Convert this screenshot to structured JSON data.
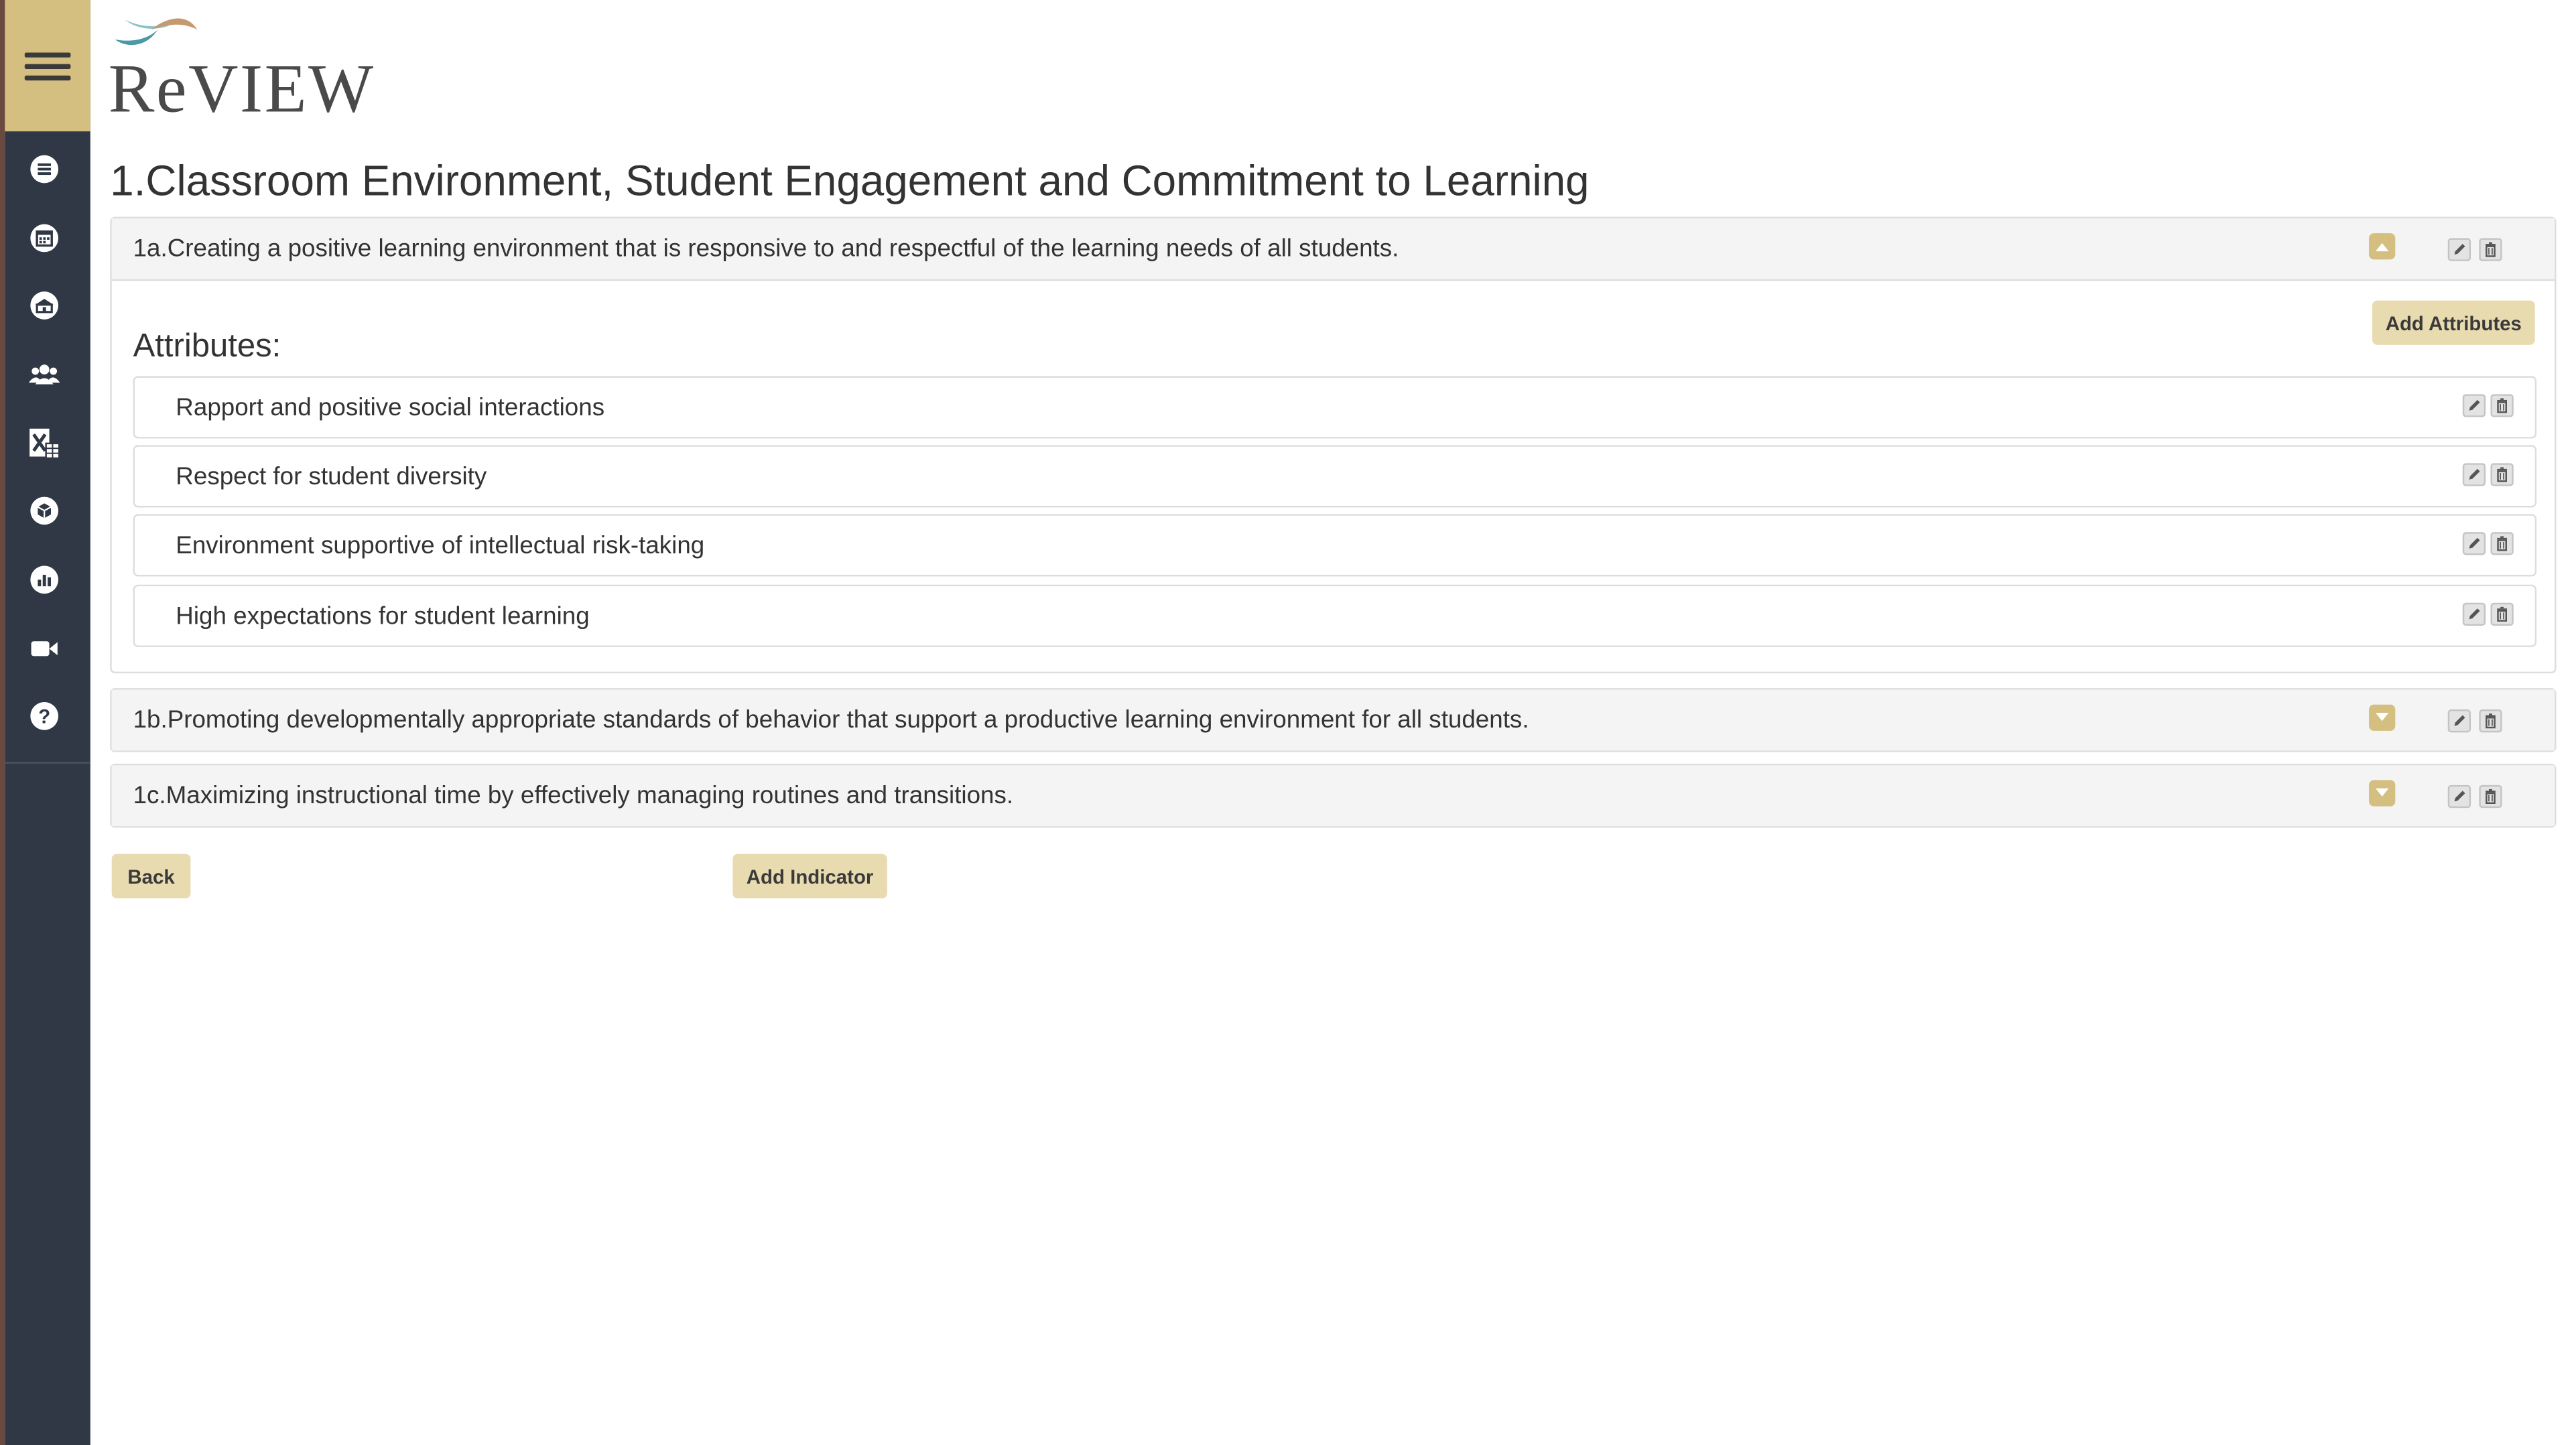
{
  "app": {
    "brand": "ReVIEW",
    "colors": {
      "sidebar": "#303845",
      "accent": "#d4be80",
      "button": "#e9dbb0"
    }
  },
  "sidebar": {
    "toggle_icon": "hamburger-menu-icon",
    "items": [
      {
        "icon": "list-icon"
      },
      {
        "icon": "calendar-icon"
      },
      {
        "icon": "school-building-icon"
      },
      {
        "icon": "users-icon"
      },
      {
        "icon": "excel-icon"
      },
      {
        "icon": "box-icon"
      },
      {
        "icon": "bar-chart-icon"
      },
      {
        "icon": "video-camera-icon"
      },
      {
        "icon": "help-icon"
      }
    ]
  },
  "main": {
    "title": "1.Classroom Environment, Student Engagement and Commitment to Learning",
    "indicators": [
      {
        "label": "1a.Creating a positive learning environment that is responsive to and respectful of the learning needs of all students.",
        "expanded": true,
        "attributes_heading": "Attributes:",
        "add_attributes_label": "Add Attributes",
        "attributes": [
          "Rapport and positive social interactions",
          "Respect for student diversity",
          "Environment supportive of intellectual risk-taking",
          "High expectations for student learning"
        ]
      },
      {
        "label": "1b.Promoting developmentally appropriate standards of behavior that support a productive learning environment for all students.",
        "expanded": false
      },
      {
        "label": "1c.Maximizing instructional time by effectively managing routines and transitions.",
        "expanded": false
      }
    ],
    "back_label": "Back",
    "add_indicator_label": "Add Indicator"
  }
}
